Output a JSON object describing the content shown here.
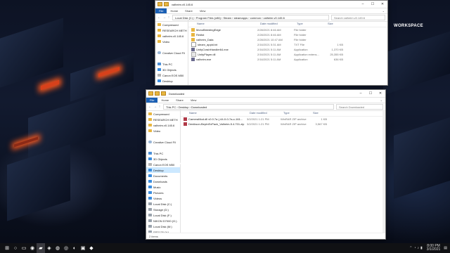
{
  "wallpaper": {
    "text": "WORKSPACE"
  },
  "top_window": {
    "title": "valheim.v0.145.6",
    "ribbon": [
      "File",
      "Home",
      "Share",
      "View"
    ],
    "path": "Local Disk (C:)  ›  Program Files (x86)  ›  Steam  ›  steamapps  ›  common  ›  valheim.v0.145.6",
    "search_placeholder": "Search valheim.v0.145.6",
    "nav_items": [
      {
        "label": "Compressed",
        "icon": "folder"
      },
      {
        "label": "RESEARCH METH",
        "icon": "folder"
      },
      {
        "label": "valheim.v0.145.6",
        "icon": "folder"
      },
      {
        "label": "Video",
        "icon": "folder"
      },
      {
        "label": "",
        "icon": ""
      },
      {
        "label": "Creative Cloud Fil",
        "icon": "cloud"
      },
      {
        "label": "",
        "icon": ""
      },
      {
        "label": "This PC",
        "icon": "pc"
      },
      {
        "label": "3D Objects",
        "icon": "blue"
      },
      {
        "label": "Canon EOS M50",
        "icon": "grey"
      },
      {
        "label": "Desktop",
        "icon": "blue"
      },
      {
        "label": "Documents",
        "icon": "blue"
      },
      {
        "label": "Downloads",
        "icon": "blue"
      }
    ],
    "columns": [
      "Name",
      "Date modified",
      "Type",
      "Size"
    ],
    "files": [
      {
        "name": "MonoBleedingEdge",
        "date": "2/28/2021 8:46 AM",
        "type": "File folder",
        "size": "",
        "icon": "folder"
      },
      {
        "name": "Redist",
        "date": "2/28/2021 8:46 AM",
        "type": "File folder",
        "size": "",
        "icon": "folder"
      },
      {
        "name": "valheim_Data",
        "date": "2/28/2021 10:47 AM",
        "type": "File folder",
        "size": "",
        "icon": "folder"
      },
      {
        "name": "steam_appid.txt",
        "date": "2/16/2021 5:31 AM",
        "type": "TXT File",
        "size": "1 KB",
        "icon": "txt"
      },
      {
        "name": "UnityCrashHandler64.exe",
        "date": "2/16/2021 5:11 AM",
        "type": "Application",
        "size": "1,370 KB",
        "icon": "exe"
      },
      {
        "name": "UnityPlayer.dll",
        "date": "2/16/2021 5:11 AM",
        "type": "Application extens...",
        "size": "25,355 KB",
        "icon": "dll"
      },
      {
        "name": "valheim.exe",
        "date": "2/16/2021 5:11 AM",
        "type": "Application",
        "size": "636 KB",
        "icon": "exe"
      }
    ]
  },
  "downloads_window": {
    "title": "Downloaded",
    "ribbon": [
      "File",
      "Home",
      "Share",
      "View"
    ],
    "path": "This PC  ›  Desktop  ›  Downloaded",
    "search_placeholder": "Search Downloaded",
    "nav_items": [
      {
        "label": "Compressed",
        "icon": "folder"
      },
      {
        "label": "RESEARCH METH",
        "icon": "folder"
      },
      {
        "label": "valheim.v0.145.6",
        "icon": "folder"
      },
      {
        "label": "Video",
        "icon": "folder"
      },
      {
        "label": "",
        "icon": ""
      },
      {
        "label": "Creative Cloud Fil",
        "icon": "cloud"
      },
      {
        "label": "",
        "icon": ""
      },
      {
        "label": "This PC",
        "icon": "pc"
      },
      {
        "label": "3D Objects",
        "icon": "blue"
      },
      {
        "label": "Canon EOS M50",
        "icon": "grey"
      },
      {
        "label": "Desktop",
        "icon": "blue",
        "selected": true
      },
      {
        "label": "Documents",
        "icon": "blue"
      },
      {
        "label": "Downloads",
        "icon": "blue"
      },
      {
        "label": "Music",
        "icon": "blue"
      },
      {
        "label": "Pictures",
        "icon": "blue"
      },
      {
        "label": "Videos",
        "icon": "blue"
      },
      {
        "label": "Local Disk (C:)",
        "icon": "drive"
      },
      {
        "label": "Storage (D:)",
        "icon": "drive"
      },
      {
        "label": "Local Disk (F:)",
        "icon": "drive"
      },
      {
        "label": "NIKON D7000 (G:)",
        "icon": "drive"
      },
      {
        "label": "Local Disk (M:)",
        "icon": "drive"
      },
      {
        "label": "SSD120 (Y:)",
        "icon": "drive"
      }
    ],
    "columns": [
      "Name",
      "Date modified",
      "Type",
      "Size"
    ],
    "files": [
      {
        "name": "CameraMod.dll v0.0.7a (-44-0-0-7a-c-161...",
        "date": "3/2/2021 1:21 PM",
        "type": "WinRAR ZIP archive",
        "size": "1 KB",
        "icon": "zip"
      },
      {
        "name": "Denikson-BepInExPack_Valheim-5.4.701.zip",
        "date": "3/2/2021 1:21 PM",
        "type": "WinRAR ZIP archive",
        "size": "3,567 KB",
        "icon": "zip"
      }
    ],
    "status": "2 items"
  },
  "taskbar": {
    "icons": [
      {
        "name": "start-icon",
        "glyph": "⊞"
      },
      {
        "name": "search-icon",
        "glyph": "○"
      },
      {
        "name": "task-view-icon",
        "glyph": "▭"
      },
      {
        "name": "chrome-icon",
        "glyph": "◉"
      },
      {
        "name": "file-explorer-icon",
        "glyph": "▰"
      },
      {
        "name": "app-icon-1",
        "glyph": "◈"
      },
      {
        "name": "app-icon-2",
        "glyph": "◍"
      },
      {
        "name": "app-icon-3",
        "glyph": "◎"
      },
      {
        "name": "app-icon-4",
        "glyph": "◐"
      },
      {
        "name": "app-icon-5",
        "glyph": "▣"
      },
      {
        "name": "app-icon-6",
        "glyph": "◆"
      }
    ],
    "time": "8:00 PM",
    "date": "3/1/2021"
  }
}
